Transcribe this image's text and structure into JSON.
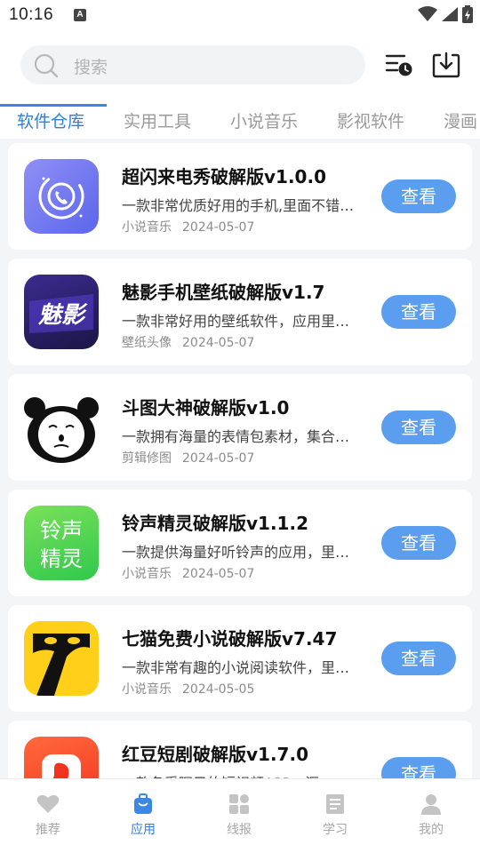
{
  "status_bar": {
    "time": "10:16",
    "notification_glyph": "A"
  },
  "search": {
    "placeholder": "搜索"
  },
  "header_icons": [
    "queue-history-icon",
    "download-icon"
  ],
  "tabs": [
    {
      "label": "软件仓库",
      "active": true
    },
    {
      "label": "实用工具",
      "active": false
    },
    {
      "label": "小说音乐",
      "active": false
    },
    {
      "label": "影视软件",
      "active": false
    },
    {
      "label": "漫画",
      "active": false
    }
  ],
  "apps": [
    {
      "title": "超闪来电秀破解版v1.0.0",
      "desc": "一款非常优质好用的手机,里面不错的来电秀软件",
      "category": "小说音乐",
      "date": "2024-05-07",
      "button": "查看",
      "icon": "phone-call-icon"
    },
    {
      "title": "魅影手机壁纸破解版v1.7",
      "desc": "一款非常好用的壁纸软件，应用里面有海量壁纸",
      "category": "壁纸头像",
      "date": "2024-05-07",
      "button": "查看",
      "icon": "meiying-logo-icon",
      "icon_text": "魅影"
    },
    {
      "title": "斗图大神破解版v1.0",
      "desc": "一款拥有海量的表情包素材，集合各种斗图素材",
      "category": "剪辑修图",
      "date": "2024-05-07",
      "button": "查看",
      "icon": "panda-meme-icon"
    },
    {
      "title": "铃声精灵破解版v1.1.2",
      "desc": "一款提供海量好听铃声的应用，里面有很多铃声",
      "category": "小说音乐",
      "date": "2024-05-07",
      "button": "查看",
      "icon": "ringtone-logo-icon",
      "icon_text": [
        "铃声",
        "精灵"
      ]
    },
    {
      "title": "七猫免费小说破解版v7.47",
      "desc": "一款非常有趣的小说阅读软件，里面有海量小说",
      "category": "小说音乐",
      "date": "2024-05-05",
      "button": "查看",
      "icon": "qimao-cat-icon"
    },
    {
      "title": "红豆短剧破解版v1.7.0",
      "desc": "一款备受瞩目的短视频APP，汇",
      "category": "",
      "date": "",
      "button": "查看",
      "icon": "red-bean-icon"
    }
  ],
  "bottom_nav": [
    {
      "label": "推荐",
      "icon": "heart-icon",
      "active": false
    },
    {
      "label": "应用",
      "icon": "bag-icon",
      "active": true
    },
    {
      "label": "线报",
      "icon": "grid-icon",
      "active": false
    },
    {
      "label": "学习",
      "icon": "document-icon",
      "active": false
    },
    {
      "label": "我的",
      "icon": "user-icon",
      "active": false
    }
  ],
  "colors": {
    "accent": "#2f7fdd",
    "button": "#5b9ef0",
    "background": "#f4f5f7"
  }
}
